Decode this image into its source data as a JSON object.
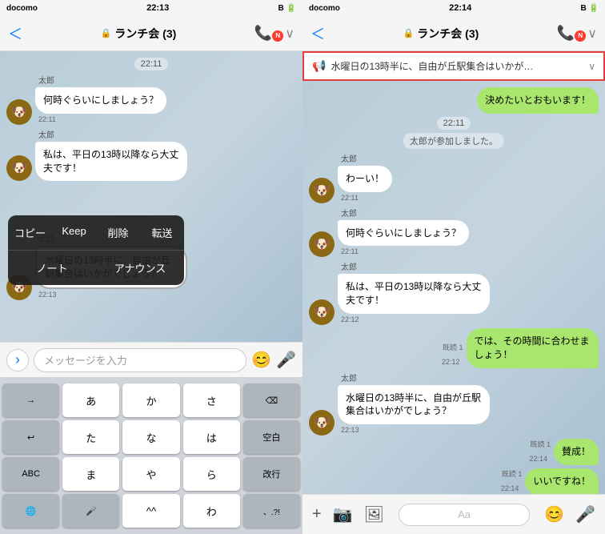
{
  "left_panel": {
    "status_bar": {
      "carrier": "docomo",
      "signal": "▋▋▋",
      "wifi": "WiFi",
      "time": "22:13",
      "bluetooth": "B",
      "battery": "🔋"
    },
    "header": {
      "title": "ランチ会 (3)",
      "back_label": "＜",
      "call_label": "📞",
      "chevron": "∨"
    },
    "messages": [
      {
        "id": "m1",
        "type": "time",
        "text": "22:11"
      },
      {
        "id": "m2",
        "type": "left",
        "sender": "太郎",
        "text": "何時ぐらいにしましょう？",
        "time": "22:11"
      },
      {
        "id": "m3",
        "type": "left",
        "sender": "太郎",
        "text": "私は、平日の13時以降なら大丈夫です！",
        "time": ""
      },
      {
        "id": "m4",
        "type": "selected",
        "sender": "太郎",
        "text": "水曜日の13時半に、自由が丘駅集合はいかがでしょう？",
        "time": "22:13"
      }
    ],
    "context_menu": {
      "row1": [
        "コピー",
        "Keep",
        "削除",
        "転送"
      ],
      "row2": [
        "ノート",
        "アナウンス"
      ]
    },
    "input": {
      "placeholder": "メッセージを入力"
    },
    "keyboard": {
      "rows": [
        [
          "→",
          "あ",
          "か",
          "さ",
          "⌫"
        ],
        [
          "↩",
          "た",
          "な",
          "は",
          "空白"
        ],
        [
          "ABC",
          "ま",
          "や",
          "ら",
          "改行"
        ],
        [
          "🌐",
          "🎤",
          "^^",
          "わ",
          "、.?!"
        ]
      ]
    }
  },
  "right_panel": {
    "status_bar": {
      "carrier": "docomo",
      "time": "22:14",
      "bluetooth": "B",
      "battery": "🔋"
    },
    "header": {
      "title": "ランチ会 (3)",
      "back_label": "＜",
      "call_label": "📞"
    },
    "announce_bar": {
      "icon": "📢",
      "text": "水曜日の13時半に、自由が丘駅集合はいかが…"
    },
    "messages": [
      {
        "id": "r1",
        "type": "right",
        "text": "決めたいとおもいます！",
        "time": ""
      },
      {
        "id": "r2",
        "type": "system",
        "text": "22:11"
      },
      {
        "id": "r3",
        "type": "system",
        "text": "太郎が参加しました。"
      },
      {
        "id": "r4",
        "type": "left",
        "sender": "太郎",
        "text": "わーい！",
        "time": "22:11"
      },
      {
        "id": "r5",
        "type": "left",
        "sender": "太郎",
        "text": "何時ぐらいにしましょう？",
        "time": "22:11"
      },
      {
        "id": "r6",
        "type": "left",
        "sender": "太郎",
        "text": "私は、平日の13時以降なら大丈夫です！",
        "time": "22:12"
      },
      {
        "id": "r7",
        "type": "right",
        "text": "では、その時間に合わせましょう！",
        "time": "22:12",
        "read": "既読 1"
      },
      {
        "id": "r8",
        "type": "left",
        "sender": "太郎",
        "text": "水曜日の13時半に、自由が丘駅集合はいかがでしょう？",
        "time": "22:13"
      },
      {
        "id": "r9",
        "type": "right",
        "text": "賛成！",
        "time": "22:14",
        "read": "既読 1"
      },
      {
        "id": "r10",
        "type": "right",
        "text": "いいですね！",
        "time": "22:14",
        "read": "既読 1"
      }
    ],
    "toolbar": {
      "plus": "+",
      "camera": "📷",
      "image": "🖼",
      "aa": "Aa",
      "emoji": "😊",
      "mic": "🎤"
    }
  }
}
